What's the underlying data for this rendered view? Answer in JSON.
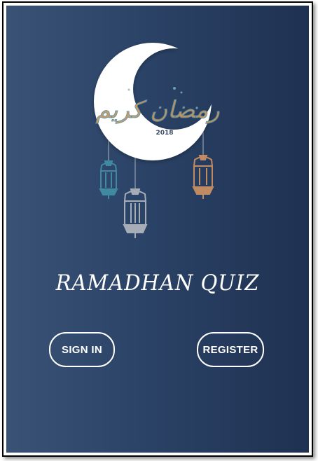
{
  "logo": {
    "calligraphy_text": "رمضان كريم",
    "year": "2018"
  },
  "app": {
    "title": "RAMADHAN QUIZ"
  },
  "actions": {
    "sign_in_label": "SIGN IN",
    "register_label": "REGISTER"
  },
  "colors": {
    "background_start": "#3a5275",
    "background_end": "#1f3151",
    "crescent": "#ffffff",
    "lantern_teal": "#3f8aa0",
    "lantern_gray": "#a7adb6",
    "lantern_copper": "#c08a62"
  }
}
